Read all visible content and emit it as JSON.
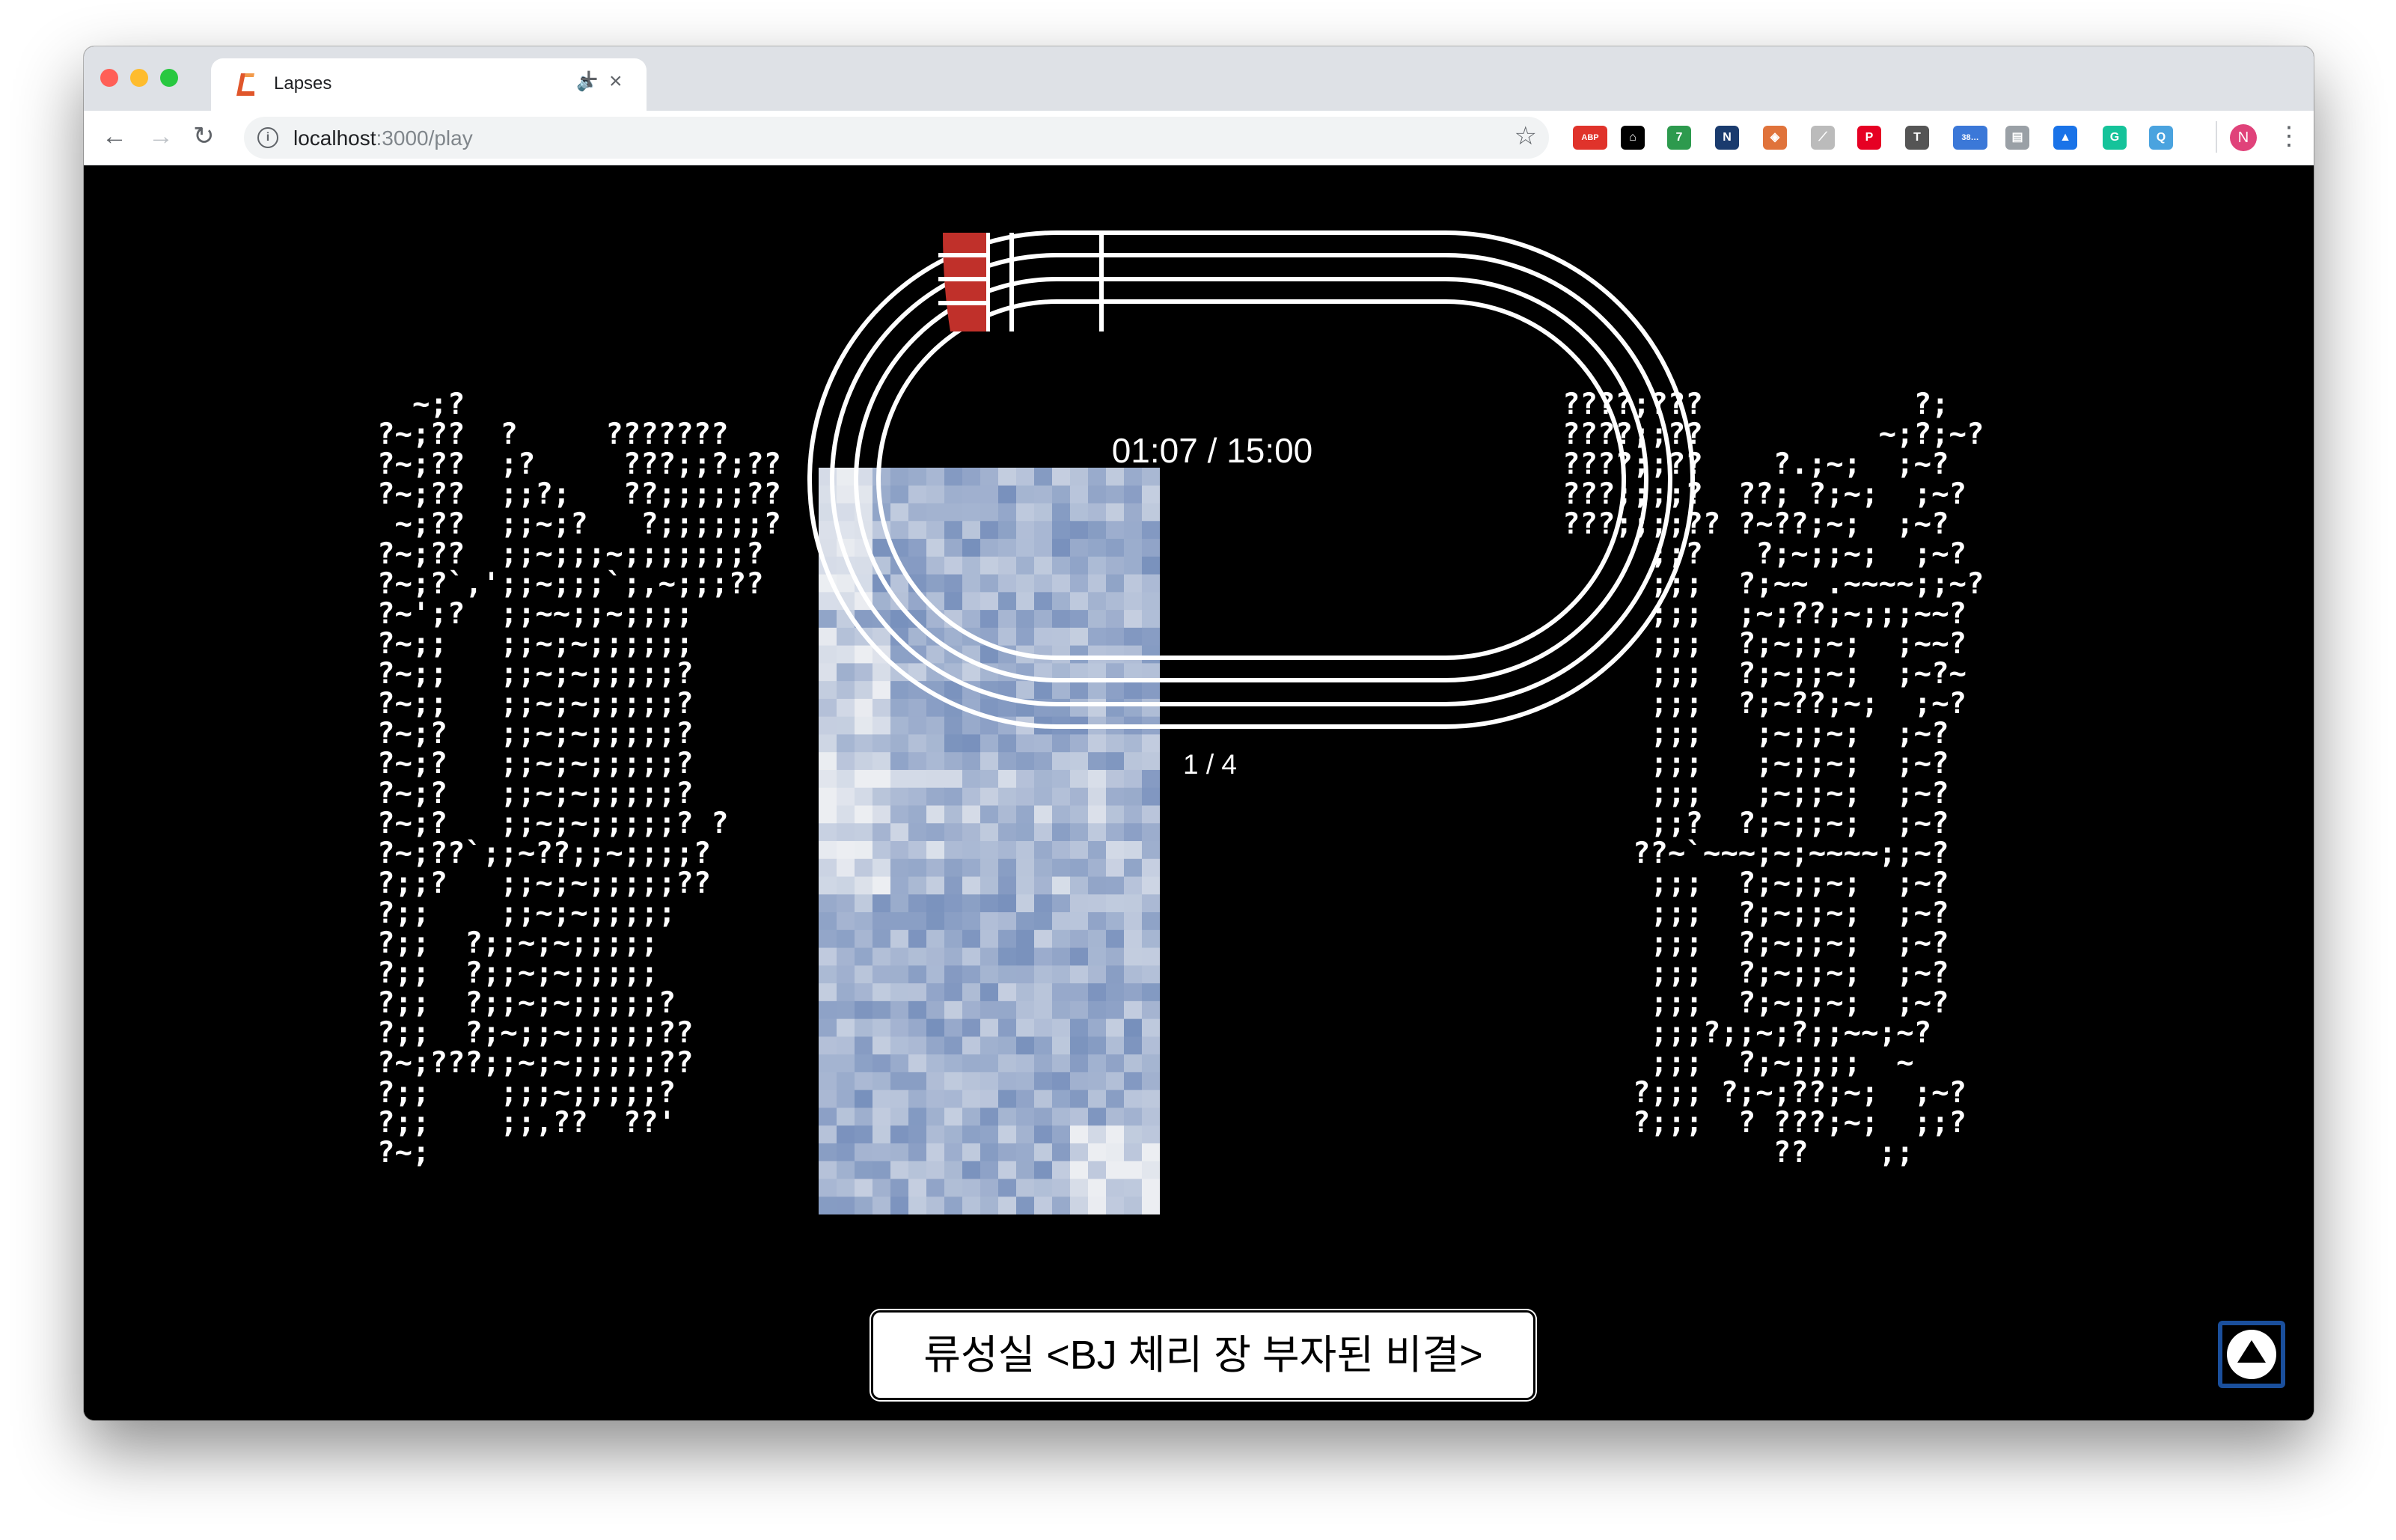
{
  "browser": {
    "tab_title": "Lapses",
    "new_tab_label": "+",
    "tab_close_label": "×",
    "url_host": "localhost",
    "url_path": ":3000/play",
    "extensions": [
      {
        "name": "adblock-icon",
        "label": "ABP",
        "color": "#e0332b"
      },
      {
        "name": "home-icon",
        "label": "⌂",
        "color": "#000000"
      },
      {
        "name": "grammar-extension-icon",
        "label": "7",
        "color": "#2d9a4e"
      },
      {
        "name": "n-extension-icon",
        "label": "N",
        "color": "#1a3b6e"
      },
      {
        "name": "shield-extension-icon",
        "label": "◈",
        "color": "#e0733b"
      },
      {
        "name": "pin-extension-icon",
        "label": "⟋",
        "color": "#bbbbbb"
      },
      {
        "name": "pinterest-icon",
        "label": "P",
        "color": "#e60023"
      },
      {
        "name": "t-extension-icon",
        "label": "T",
        "color": "#555555"
      },
      {
        "name": "cloud-extension-icon",
        "label": "38…",
        "color": "#3b78d8"
      },
      {
        "name": "flag-extension-icon",
        "label": "▤",
        "color": "#9aa0a6"
      },
      {
        "name": "graduation-cap-icon",
        "label": "▲",
        "color": "#1a73e8"
      },
      {
        "name": "grammarly-icon",
        "label": "G",
        "color": "#15c39a"
      },
      {
        "name": "search-extension-icon",
        "label": "Q",
        "color": "#4aa3df"
      }
    ],
    "profile_initial": "N"
  },
  "player": {
    "timer": "01:07 / 15:00",
    "page_counter": "1 / 4",
    "caption": "류성실 <BJ 체리 장 부자된 비결>",
    "progress_fraction": 0.074,
    "colors": {
      "track_lines": "#ffffff",
      "progress_fill": "#c0302a",
      "background": "#000000",
      "up_button_border": "#1a4f9c"
    }
  },
  "ascii_left": "  ~;?\n?~;??  ?     ???????\n?~;??  ;?     ???;;?;??\n?~;??  ;;?;   ??;;;;;??\n ~;??  ;;~;?   ?;;;;;;?\n?~;??  ;;~;;;~;;;;;;;?\n?~;?`,';;~;;;`;,~;;;??\n?~';?  ;;~~;;~;;;;\n?~;;   ;;~;~;;;;;;\n?~;;   ;;~;~;;;;;?\n?~;;   ;;~;~;;;;;?\n?~;?   ;;~;~;;;;;?\n?~;?   ;;~;~;;;;;?\n?~;?   ;;~;~;;;;;?\n?~;?   ;;~;~;;;;;? ?\n?~;??`;;~??;;~;;;;?\n?;;?   ;;~;~;;;;;??\n?;;    ;;~;~;;;;;\n?;;  ?;;~;~;;;;;\n?;;  ?;;~;~;;;;;\n?;;  ?;;~;~;;;;;?\n?;;  ?;~;;~;;;;;??\n?~;???;;~;~;;;;;??\n?;;    ;;;~;;;;;?\n?;;    ;;,??  ??'\n?~;",
  "ascii_right": "????;???            ?;\n????;;??          ~;?;~?\n????;;??    ?.;~;  ;~?\n???;;;;?  ??; ?;~;  ;~?\n???;;;;?? ?~??;~;  ;~?\n     ;;?   ?;~;;~;  ;~?\n     ;;;  ?;~~ .~~~~;;~?\n     ;;;  ;~;??;~;;;~~?\n     ;;;  ?;~;;~;  ;~~?\n     ;;;  ?;~;;~;  ;~?~\n     ;;;  ?;~??;~;  ;~?\n     ;;;   ;~;;~;  ;~?\n     ;;;   ;~;;~;  ;~?\n     ;;;   ;~;;~;  ;~?\n     ;;?  ?;~;;~;  ;~?\n    ??~`~~~;~;~~~~;;~?\n     ;;;  ?;~;;~;  ;~?\n     ;;;  ?;~;;~;  ;~?\n     ;;;  ?;~;;~;  ;~?\n     ;;;  ?;~;;~;  ;~?\n     ;;;  ?;~;;~;  ;~?\n     ;;;?;;~;?;;~~;~?\n     ;;;  ?;~;;;;  ~\n    ?;;; ?;~;??;~;  ;~?\n    ?;;;  ? ???;~;  ;;?\n            ??    ;;"
}
